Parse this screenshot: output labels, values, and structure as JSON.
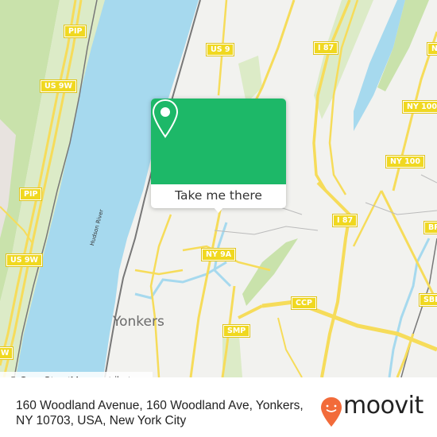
{
  "map": {
    "colors": {
      "water": "#a6d9ee",
      "land": "#f2f2ef",
      "park": "#dcebc7",
      "forest": "#c9e2ab",
      "road": "#f6dc5a",
      "rail": "#777777",
      "shield": "#f0d820"
    },
    "place_labels": [
      {
        "name": "yonkers",
        "text": "Yonkers"
      }
    ],
    "water_labels": [
      {
        "name": "hudson-river",
        "text": "Hudson River"
      }
    ],
    "route_shields": [
      {
        "id": "pip-1",
        "text": "PIP"
      },
      {
        "id": "us9w-1",
        "text": "US 9W"
      },
      {
        "id": "pip-2",
        "text": "PIP"
      },
      {
        "id": "us9w-2",
        "text": "US 9W"
      },
      {
        "id": "w-edge",
        "text": "W"
      },
      {
        "id": "us9",
        "text": "US 9"
      },
      {
        "id": "i87-1",
        "text": "I 87"
      },
      {
        "id": "ny-top",
        "text": "NY"
      },
      {
        "id": "ny100-1",
        "text": "NY 100"
      },
      {
        "id": "ny100-2",
        "text": "NY 100"
      },
      {
        "id": "i87-2",
        "text": "I 87"
      },
      {
        "id": "br",
        "text": "BR"
      },
      {
        "id": "ny9a",
        "text": "NY 9A"
      },
      {
        "id": "ccp",
        "text": "CCP"
      },
      {
        "id": "sbp",
        "text": "SBP"
      },
      {
        "id": "smp",
        "text": "SMP"
      }
    ],
    "attribution": "© OpenStreetMap contributors"
  },
  "popup": {
    "icon": "map-pin-icon",
    "button_label": "Take me there",
    "accent_color": "#1db868"
  },
  "footer": {
    "address_line1": "160 Woodland Avenue, 160 Woodland Ave, Yonkers,",
    "address_line2": "NY 10703, USA, New York City",
    "brand": "moovit",
    "brand_color": "#f26b3a"
  }
}
